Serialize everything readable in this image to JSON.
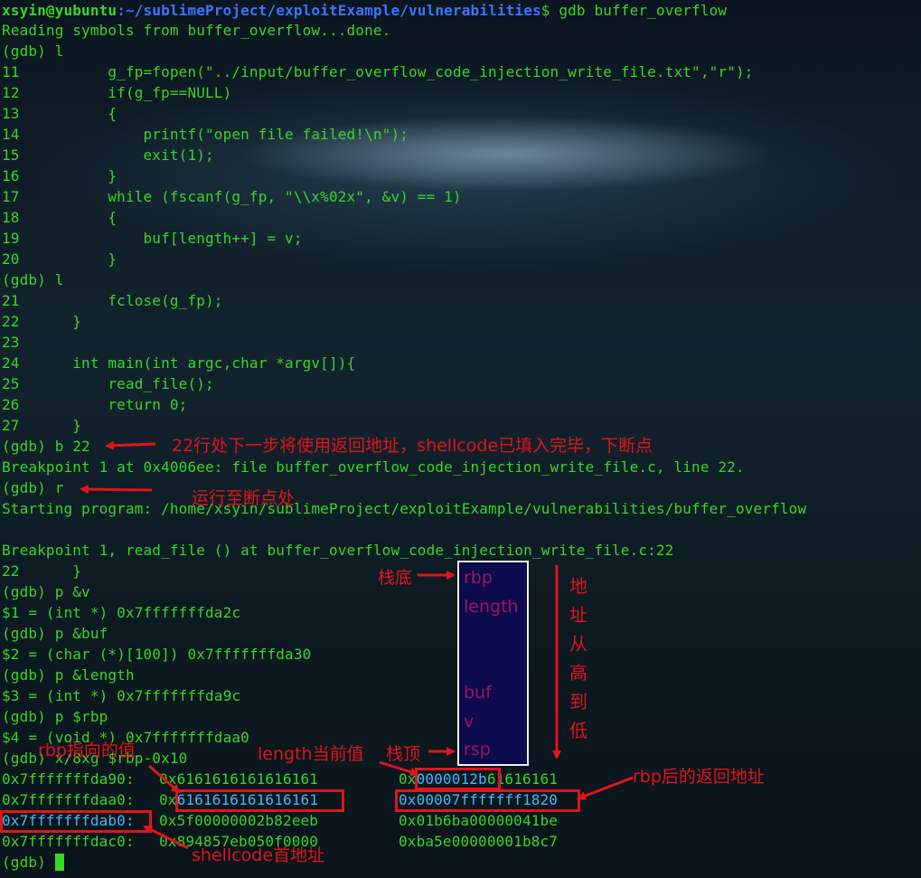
{
  "prompt": {
    "user_host": "xsyin@yubuntu",
    "path": ":~/sublimeProject/exploitExample/vulnerabilities",
    "command": "$ gdb buffer_overflow"
  },
  "lines": {
    "l1": "Reading symbols from buffer_overflow...done.",
    "l2": "(gdb) l",
    "l3": "11          g_fp=fopen(\"../input/buffer_overflow_code_injection_write_file.txt\",\"r\");",
    "l4": "12          if(g_fp==NULL)",
    "l5": "13          {",
    "l6": "14              printf(\"open file failed!\\n\");",
    "l7": "15              exit(1);",
    "l8": "16          }",
    "l9": "17          while (fscanf(g_fp, \"\\\\x%02x\", &v) == 1)",
    "l10": "18          {",
    "l11": "19              buf[length++] = v;",
    "l12": "20          }",
    "l13": "(gdb) l",
    "l14": "21          fclose(g_fp);",
    "l15": "22      }",
    "l16": "23",
    "l17": "24      int main(int argc,char *argv[]){",
    "l18": "25          read_file();",
    "l19": "26          return 0;",
    "l20": "27      }",
    "l21": "(gdb) b 22",
    "l22": "Breakpoint 1 at 0x4006ee: file buffer_overflow_code_injection_write_file.c, line 22.",
    "l23": "(gdb) r",
    "l24": "Starting program: /home/xsyin/sublimeProject/exploitExample/vulnerabilities/buffer_overflow",
    "l25": "",
    "l26": "Breakpoint 1, read_file () at buffer_overflow_code_injection_write_file.c:22",
    "l27": "22      }",
    "l28": "(gdb) p &v",
    "l29": "$1 = (int *) 0x7fffffffda2c",
    "l30": "(gdb) p &buf",
    "l31": "$2 = (char (*)[100]) 0x7fffffffda30",
    "l32": "(gdb) p &length",
    "l33": "$3 = (int *) 0x7fffffffda9c",
    "l34": "(gdb) p $rbp",
    "l35": "$4 = (void *) 0x7fffffffdaa0",
    "l36": "(gdb) x/8xg $rbp-0x10"
  },
  "memory": {
    "r1_addr": "0x7fffffffda90:",
    "r1_a": "0x6161616161616161",
    "r1_b_pre": "0x",
    "r1_b_hl": "0000012b",
    "r1_b_post": "61616161",
    "r2_addr": "0x7fffffffdaa0:",
    "r2_a_pre": "0x",
    "r2_a_hl": "6161616161616161",
    "r2_b_hl": "0x00007fffffff1820",
    "r3_addr": "0x7fffffffdab0:",
    "r3_a": "0x5f00000002b82eeb",
    "r3_b": "0x01b6ba00000041be",
    "r4_addr": "0x7fffffffdac0:",
    "r4_a": "0x894857eb050f0000",
    "r4_b": "0xba5e00000001b8c7"
  },
  "final_prompt": "(gdb) ",
  "annotations": {
    "a_break": "22行处下一步将使用返回地址，shellcode已填入完毕，下断点",
    "a_run": "运行至断点处",
    "a_stack_bottom": "栈底",
    "a_stack_top": "栈顶",
    "a_rbp_value": "rbp指向的值",
    "a_length_value": "length当前值",
    "a_return_addr": "rbp后的返回地址",
    "a_shellcode": "shellcode首地址",
    "a_direction": [
      "地",
      "址",
      "从",
      "高",
      "到",
      "低"
    ]
  },
  "stack_labels": {
    "rbp": "rbp",
    "length": "length",
    "buf": "buf",
    "v": "v",
    "rsp": "rsp"
  },
  "colors": {
    "terminal_text": "#37d627",
    "prompt_path": "#3b74ff",
    "annotation": "#e0141b",
    "highlight": "#3fb9ff",
    "stack_bg": "#0b0b4e",
    "stack_text": "#a0165a"
  }
}
